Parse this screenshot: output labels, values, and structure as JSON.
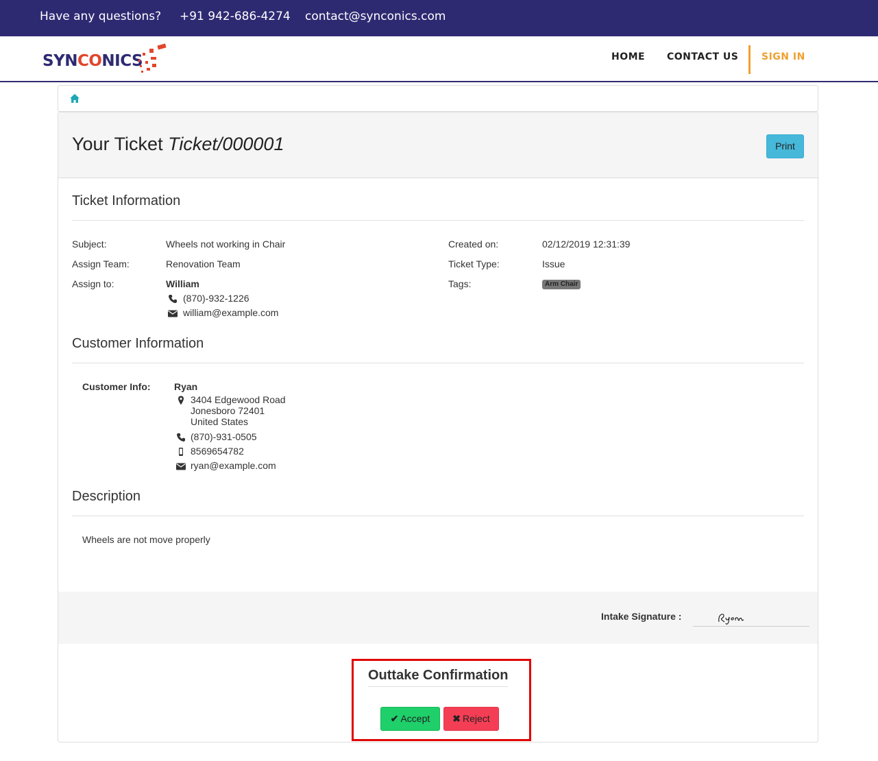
{
  "topbar": {
    "question": "Have any questions?",
    "phone": "+91 942-686-4274",
    "email": "contact@synconics.com"
  },
  "brand": {
    "logo_part1": "SYN",
    "logo_part2": "CO",
    "logo_part3": "NICS",
    "primary_color": "#2e2a72",
    "accent_color": "#e2462c"
  },
  "nav": {
    "home": "HOME",
    "contact": "CONTACT US",
    "signin": "SIGN IN",
    "signin_color": "#f0a030"
  },
  "breadcrumb": {
    "home_icon": "home-icon"
  },
  "ticket": {
    "title_prefix": "Your Ticket",
    "ticket_id": "Ticket/000001",
    "print_label": "Print"
  },
  "ticket_info": {
    "heading": "Ticket Information",
    "subject_label": "Subject:",
    "subject": "Wheels not working in Chair",
    "assign_team_label": "Assign Team:",
    "assign_team": "Renovation Team",
    "assign_to_label": "Assign to:",
    "assignee_name": "William",
    "assignee_phone": "(870)-932-1226",
    "assignee_email": "william@example.com",
    "created_label": "Created on:",
    "created": "02/12/2019 12:31:39",
    "type_label": "Ticket Type:",
    "type": "Issue",
    "tags_label": "Tags:",
    "tag": "Arm Chair"
  },
  "customer": {
    "heading": "Customer Information",
    "label": "Customer Info:",
    "name": "Ryan",
    "street": "3404 Edgewood Road",
    "city": "Jonesboro 72401",
    "country": "United States",
    "phone": "(870)-931-0505",
    "mobile": "8569654782",
    "email": "ryan@example.com"
  },
  "description": {
    "heading": "Description",
    "text": "Wheels are not move properly"
  },
  "signature": {
    "label": "Intake Signature :",
    "signed_name": "Ryan"
  },
  "outtake": {
    "title": "Outtake Confirmation",
    "accept_label": "Accept",
    "reject_label": "Reject",
    "accept_color": "#1fcf6a",
    "reject_color": "#f43e55"
  }
}
